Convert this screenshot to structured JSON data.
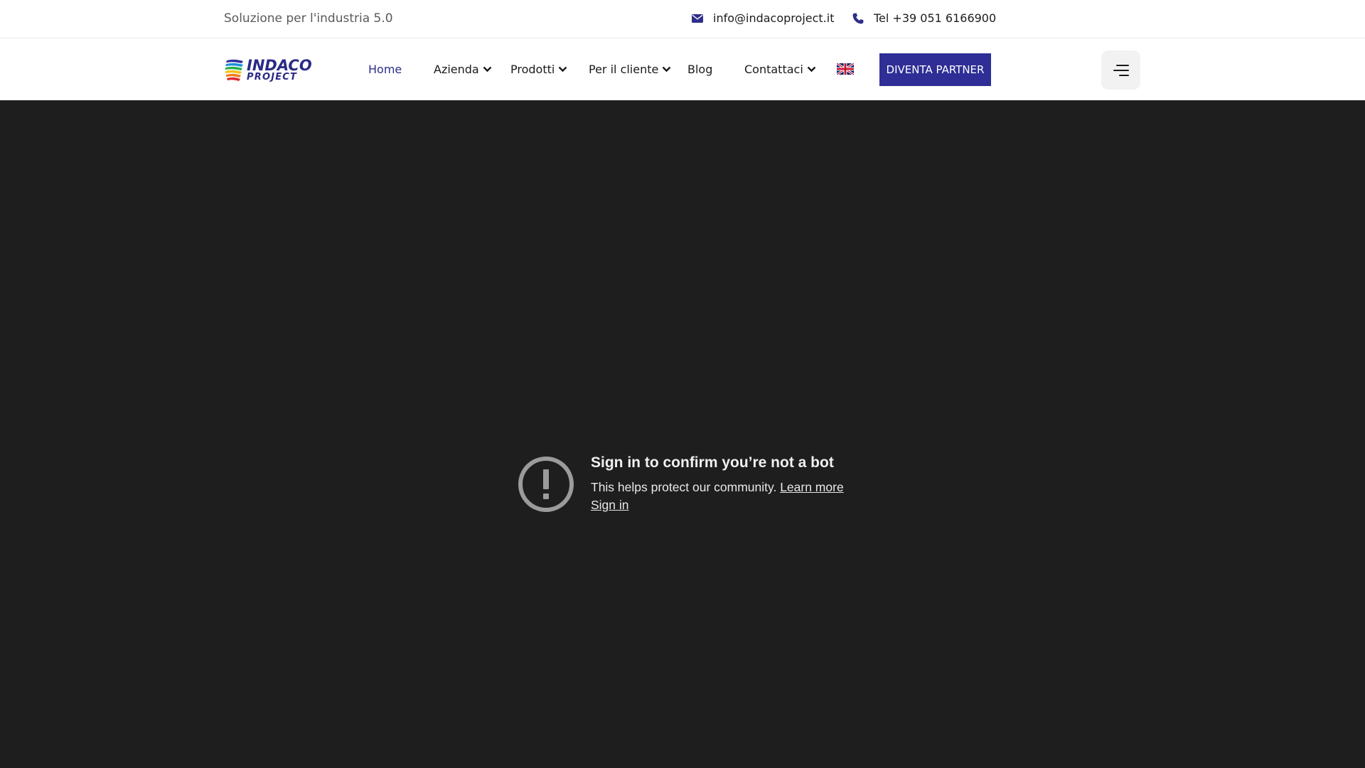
{
  "topbar": {
    "tagline": "Soluzione per l'industria 5.0",
    "email": "info@indacoproject.it",
    "phone": "Tel +39 051 6166900",
    "email_icon": "envelope-icon",
    "phone_icon": "phone-icon"
  },
  "logo": {
    "line1": "INDACO",
    "line2": "PROJECT",
    "brand_color": "#2a2a86"
  },
  "nav": {
    "items": [
      {
        "label": "Home",
        "active": true
      },
      {
        "label": "Azienda",
        "dropdown": true
      },
      {
        "label": "Prodotti",
        "dropdown": true
      },
      {
        "label": "Per il cliente",
        "dropdown": true
      },
      {
        "label": "Blog"
      },
      {
        "label": "Contattaci",
        "dropdown": true
      }
    ],
    "language_icon": "uk-flag-icon",
    "partner_button": "DIVENTA PARTNER",
    "partner_color": "#2e2e96",
    "menu_icon": "hamburger-menu-icon"
  },
  "video": {
    "title": "Sign in to confirm you’re not a bot",
    "subtitle": "This helps protect our community.",
    "learn_more": "Learn more",
    "sign_in": "Sign in",
    "background": "#1e1e1e",
    "icon": "alert-circle-icon"
  }
}
